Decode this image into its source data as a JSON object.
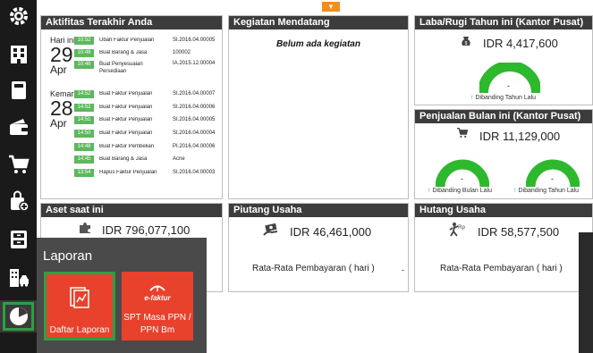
{
  "top_handle": {
    "glyph": "▼"
  },
  "sidebar": {
    "items": [
      {
        "icon": "gear-icon"
      },
      {
        "icon": "building-icon"
      },
      {
        "icon": "book-icon"
      },
      {
        "icon": "wallet-icon"
      },
      {
        "icon": "cart-icon"
      },
      {
        "icon": "bag-add-icon"
      },
      {
        "icon": "cabinet-icon"
      },
      {
        "icon": "building-car-icon"
      },
      {
        "icon": "pie-chart-icon",
        "active": true
      }
    ]
  },
  "aktifitas": {
    "title": "Aktifitas Terakhir Anda",
    "today": {
      "label": "Hari ini",
      "day": "29",
      "month": "Apr"
    },
    "yesterday": {
      "label": "Kemarin",
      "day": "28",
      "month": "Apr"
    },
    "today_rows": [
      {
        "time": "10:52",
        "desc": "Ubah Faktur Penjualan",
        "ref": "SI.2016.04.00005"
      },
      {
        "time": "10:48",
        "desc": "Buat Barang & Jasa",
        "ref": "100002"
      },
      {
        "time": "10:48",
        "desc": "Buat Penyesuaian Persediaan",
        "ref": "IA.2015.12.00004"
      }
    ],
    "yesterday_rows": [
      {
        "time": "14:52",
        "desc": "Buat Faktur Penjualan",
        "ref": "SI.2016.04.00007"
      },
      {
        "time": "14:52",
        "desc": "Buat Faktur Penjualan",
        "ref": "SI.2016.04.00006"
      },
      {
        "time": "14:51",
        "desc": "Buat Faktur Penjualan",
        "ref": "SI.2016.04.00005"
      },
      {
        "time": "14:50",
        "desc": "Buat Faktur Penjualan",
        "ref": "SI.2016.04.00004"
      },
      {
        "time": "14:48",
        "desc": "Buat Faktur Pembelian",
        "ref": "PI.2016.04.00006"
      },
      {
        "time": "14:45",
        "desc": "Buat Barang & Jasa",
        "ref": "Acne"
      },
      {
        "time": "13:54",
        "desc": "Hapus Faktur Penjualan",
        "ref": "SI.2016.04.00003"
      }
    ]
  },
  "kegiatan": {
    "title": "Kegiatan Mendatang",
    "empty": "Belum ada kegiatan"
  },
  "labarugi": {
    "title": "Laba/Rugi Tahun ini (Kantor Pusat)",
    "amount": "IDR 4,417,600",
    "gauge_value": "-",
    "caption": "Dibanding Tahun Lalu",
    "icon": "money-bag-icon"
  },
  "penjualan": {
    "title": "Penjualan Bulan ini (Kantor Pusat)",
    "amount": "IDR 11,129,000",
    "icon": "cart-icon",
    "gauge1": {
      "value": "-",
      "caption": "Dibanding Bulan Lalu"
    },
    "gauge2": {
      "value": "-",
      "caption": "Dibanding Tahun Lalu"
    }
  },
  "aset": {
    "title": "Aset saat ini",
    "amount": "IDR 796,077,100",
    "icon": "puzzle-icon"
  },
  "piutang": {
    "title": "Piutang Usaha",
    "amount": "IDR 46,461,000",
    "rata": "Rata-Rata Pembayaran ( hari )",
    "rata_value": "-",
    "icon": "money-hand-icon"
  },
  "hutang": {
    "title": "Hutang Usaha",
    "amount": "IDR 58,577,500",
    "rata": "Rata-Rata Pembayaran ( hari )",
    "rata_value": "-",
    "icon": "person-rp-icon"
  },
  "laporan_menu": {
    "title": "Laporan",
    "tiles": [
      {
        "label": "Daftar Laporan",
        "icon": "report-icon"
      },
      {
        "label_line1": "SPT Masa PPN /",
        "label_line2": "PPN Bm",
        "brand": "e-faktur",
        "icon": "efaktur-logo-icon"
      }
    ]
  },
  "colors": {
    "sidebar_bg": "#1a1a1a",
    "panel_header": "#3c3c3c",
    "accent_green": "#2f9e44",
    "gauge_green": "#2eb82e",
    "tile_red": "#e8412c",
    "handle_orange": "#f28d1f"
  }
}
